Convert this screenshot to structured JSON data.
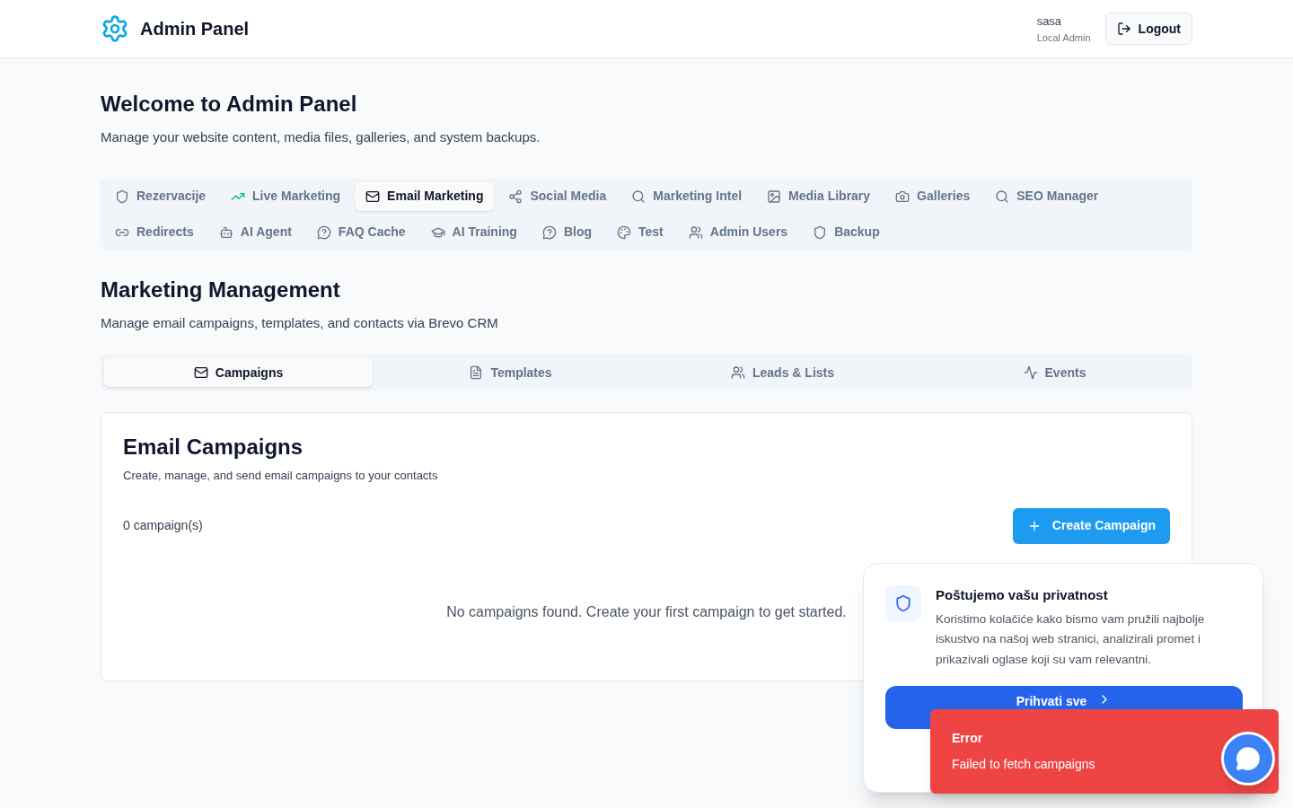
{
  "header": {
    "title": "Admin Panel",
    "user_name": "sasa",
    "user_role": "Local Admin",
    "logout": "Logout"
  },
  "welcome": {
    "title": "Welcome to Admin Panel",
    "subtitle": "Manage your website content, media files, galleries, and system backups."
  },
  "nav_tabs": [
    {
      "label": "Rezervacije",
      "selected": false
    },
    {
      "label": "Live Marketing",
      "selected": false
    },
    {
      "label": "Email Marketing",
      "selected": true
    },
    {
      "label": "Social Media",
      "selected": false
    },
    {
      "label": "Marketing Intel",
      "selected": false
    },
    {
      "label": "Media Library",
      "selected": false
    },
    {
      "label": "Galleries",
      "selected": false
    },
    {
      "label": "SEO Manager",
      "selected": false
    },
    {
      "label": "Redirects",
      "selected": false
    },
    {
      "label": "AI Agent",
      "selected": false
    },
    {
      "label": "FAQ Cache",
      "selected": false
    },
    {
      "label": "AI Training",
      "selected": false
    },
    {
      "label": "Blog",
      "selected": false
    },
    {
      "label": "Test",
      "selected": false
    },
    {
      "label": "Admin Users",
      "selected": false
    },
    {
      "label": "Backup",
      "selected": false
    }
  ],
  "section": {
    "title": "Marketing Management",
    "subtitle": "Manage email campaigns, templates, and contacts via Brevo CRM"
  },
  "sub_tabs": [
    {
      "label": "Campaigns",
      "selected": true
    },
    {
      "label": "Templates",
      "selected": false
    },
    {
      "label": "Leads & Lists",
      "selected": false
    },
    {
      "label": "Events",
      "selected": false
    }
  ],
  "card": {
    "title": "Email Campaigns",
    "subtitle": "Create, manage, and send email campaigns to your contacts",
    "count": "0 campaign(s)",
    "create_button": "Create Campaign",
    "empty_message": "No campaigns found. Create your first campaign to get started."
  },
  "cookie_banner": {
    "title": "Poštujemo vašu privatnost",
    "text": "Koristimo kolačiće kako bismo vam pružili najbolje iskustvo na našoj web stranici, analizirali promet i prikazivali oglase koji su vam relevantni.",
    "accept": "Prihvati sve"
  },
  "toast": {
    "title": "Error",
    "message": "Failed to fetch campaigns"
  }
}
